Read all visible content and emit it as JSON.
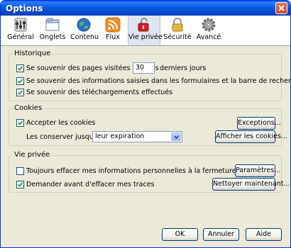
{
  "window": {
    "title": "Options"
  },
  "toolbar": {
    "tabs": [
      {
        "label": "Général",
        "icon": "general-icon"
      },
      {
        "label": "Onglets",
        "icon": "tabs-icon"
      },
      {
        "label": "Contenu",
        "icon": "globe-icon"
      },
      {
        "label": "Flux",
        "icon": "rss-icon"
      },
      {
        "label": "Vie privée",
        "icon": "privacy-mask-icon",
        "selected": true
      },
      {
        "label": "Sécurité",
        "icon": "padlock-icon"
      },
      {
        "label": "Avancé",
        "icon": "gear-icon"
      }
    ]
  },
  "history": {
    "legend": "Historique",
    "remember_pages_label": "Se souvenir des pages visitées lors des",
    "remember_pages_checked": true,
    "days_value": "30",
    "days_suffix": "derniers jours",
    "remember_forms_label": "Se souvenir des informations saisies dans les formulaires et la barre de recherche",
    "remember_forms_checked": true,
    "remember_downloads_label": "Se souvenir des téléchargements effectués",
    "remember_downloads_checked": true
  },
  "cookies": {
    "legend": "Cookies",
    "accept_label": "Accepter les cookies",
    "accept_checked": true,
    "keep_until_label": "Les conserver jusqu'à :",
    "keep_until_value": "leur expiration",
    "exceptions_button": "Exceptions...",
    "show_cookies_button": "Afficher les cookies..."
  },
  "privacy": {
    "legend": "Vie privée",
    "always_clear_label": "Toujours effacer mes informations personnelles à la fermeture de Firefox",
    "always_clear_checked": false,
    "ask_before_label": "Demander avant d'effacer mes traces",
    "ask_before_checked": true,
    "settings_button": "Paramètres...",
    "clear_now_button": "Nettoyer maintenant..."
  },
  "buttons": {
    "ok": "OK",
    "cancel": "Annuler",
    "help": "Aide"
  },
  "colors": {
    "titlebar": "#0a5ae0",
    "dialog_bg": "#ece9d8",
    "check_green": "#21a121"
  }
}
